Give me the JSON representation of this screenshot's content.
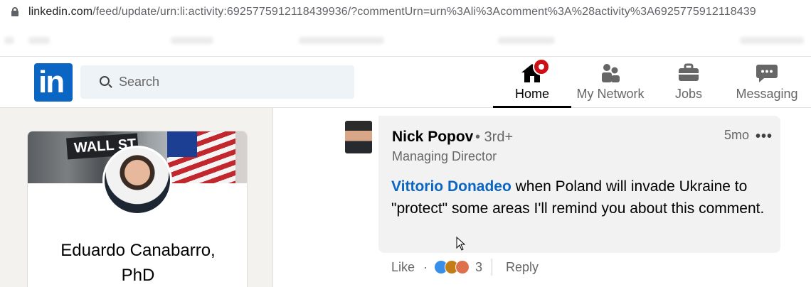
{
  "browser": {
    "url_host": "linkedin.com",
    "url_path": "/feed/update/urn:li:activity:6925775912118439936/?commentUrn=urn%3Ali%3Acomment%3A%28activity%3A6925775912118439"
  },
  "nav": {
    "search_placeholder": "Search",
    "items": [
      {
        "label": "Home",
        "icon": "home-icon",
        "active": true
      },
      {
        "label": "My Network",
        "icon": "network-icon"
      },
      {
        "label": "Jobs",
        "icon": "briefcase-icon"
      },
      {
        "label": "Messaging",
        "icon": "messaging-icon"
      }
    ]
  },
  "profile": {
    "name_line1": "Eduardo Canabarro,",
    "name_line2": "PhD",
    "cover_sign": "WALL ST"
  },
  "comment": {
    "author": "Nick Popov",
    "degree": "• 3rd+",
    "headline": "Managing Director",
    "time": "5mo",
    "mention": "Vittorio Donadeo",
    "text": " when Poland will invade Ukraine to \"protect\" some areas I'll remind you about this comment.",
    "like_label": "Like",
    "reaction_count": "3",
    "reply_label": "Reply"
  }
}
